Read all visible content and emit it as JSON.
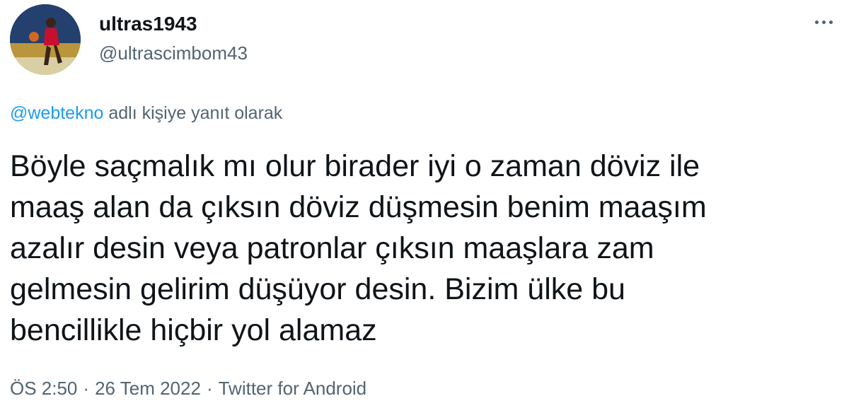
{
  "user": {
    "display_name": "ultras1943",
    "handle": "@ultrascimbom43",
    "avatar_icon": "avatar-basketball-player"
  },
  "reply": {
    "mention": "@webtekno",
    "suffix": " adlı kişiye yanıt olarak"
  },
  "tweet": {
    "text": "Böyle saçmalık mı olur birader iyi o zaman döviz ile\nmaaş alan da çıksın döviz düşmesin benim maaşım\nazalır desin veya patronlar çıksın maaşlara zam\ngelmesin gelirim düşüyor desin. Bizim ülke bu\nbencillikle hiçbir yol alamaz"
  },
  "meta": {
    "time": "ÖS 2:50",
    "separator": "·",
    "date": "26 Tem 2022",
    "source": "Twitter for Android"
  },
  "colors": {
    "link": "#1d9bf0",
    "secondary_text": "#536471",
    "primary_text": "#0f1419"
  }
}
